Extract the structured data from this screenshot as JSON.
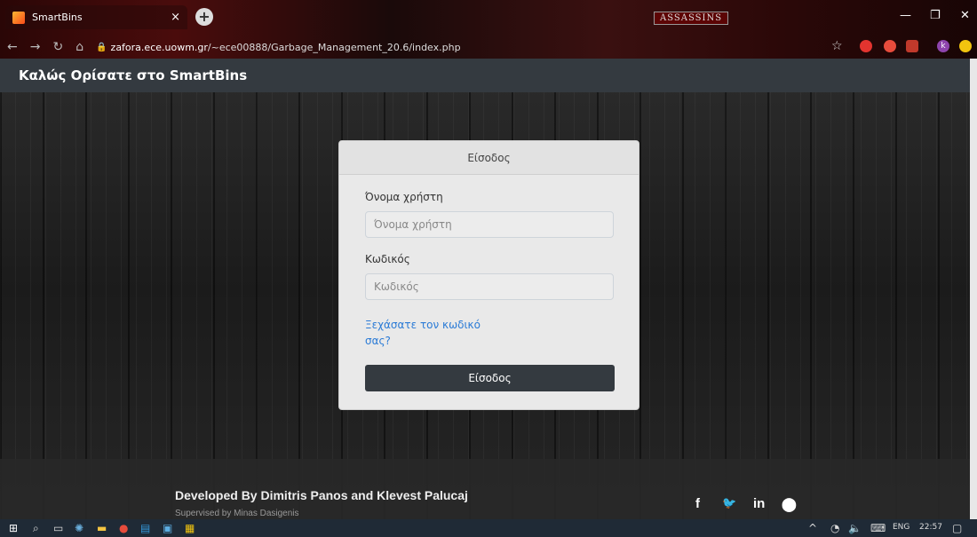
{
  "browser": {
    "tab_title": "SmartBins",
    "tab_close": "×",
    "new_tab": "+",
    "banner": "ASSASSINS",
    "url_domain": "zafora.ece.uowm.gr",
    "url_path": "/~ece00888/Garbage_Management_20.6/index.php",
    "window_controls": [
      "—",
      "❐",
      "✕"
    ]
  },
  "navbar": {
    "brand": "Καλώς Ορίσατε στο SmartBins"
  },
  "login": {
    "header": "Είσοδος",
    "username_label": "Όνομα χρήστη",
    "username_placeholder": "Όνομα χρήστη",
    "password_label": "Κωδικός",
    "password_placeholder": "Κωδικός",
    "forgot_link": "Ξεχάσατε τον κωδικό σας?",
    "submit_label": "Είσοδος"
  },
  "footer": {
    "developed_by": "Developed By Dimitris Panos and Klevest Palucaj",
    "supervised_by": "Supervised by Minas Dasigenis",
    "social": {
      "facebook": "f",
      "twitter": "🐦",
      "linkedin": "in",
      "github": "◖"
    }
  },
  "taskbar": {
    "language": "ENG",
    "time": "22:57"
  },
  "colors": {
    "accent_link": "#2b7bd6",
    "navbar": "#343a40",
    "button": "#343a40"
  }
}
